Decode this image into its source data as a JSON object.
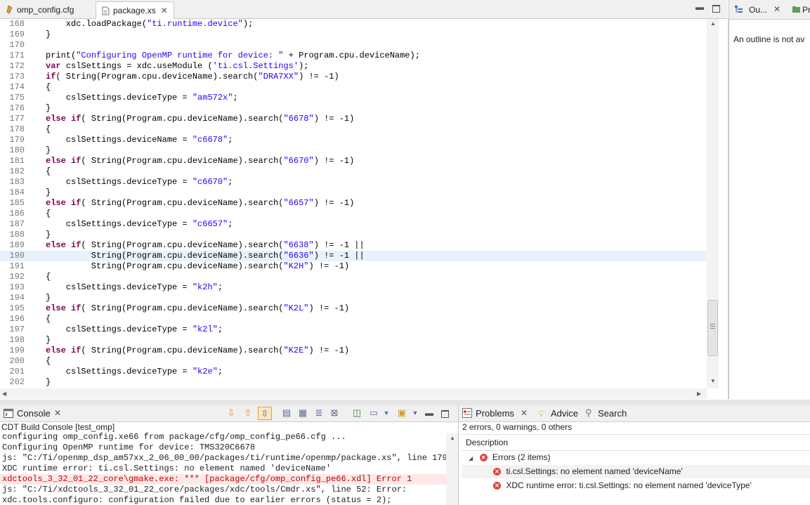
{
  "editor": {
    "tabs": [
      {
        "label": "omp_config.cfg",
        "active": false,
        "icon": "cfg-file-icon"
      },
      {
        "label": "package.xs",
        "active": true,
        "icon": "xs-file-icon"
      }
    ],
    "lines": [
      {
        "num": "168",
        "text": "    xdc.loadPackage(\"ti.runtime.device\");"
      },
      {
        "num": "169",
        "text": "}"
      },
      {
        "num": "170",
        "text": ""
      },
      {
        "num": "171",
        "text": "print(\"Configuring OpenMP runtime for device: \" + Program.cpu.deviceName);"
      },
      {
        "num": "172",
        "text": "var cslSettings = xdc.useModule ('ti.csl.Settings');"
      },
      {
        "num": "173",
        "text": "if( String(Program.cpu.deviceName).search(\"DRA7XX\") != -1)"
      },
      {
        "num": "174",
        "text": "{"
      },
      {
        "num": "175",
        "text": "    cslSettings.deviceType = \"am572x\";"
      },
      {
        "num": "176",
        "text": "}"
      },
      {
        "num": "177",
        "text": "else if( String(Program.cpu.deviceName).search(\"6678\") != -1)"
      },
      {
        "num": "178",
        "text": "{"
      },
      {
        "num": "179",
        "text": "    cslSettings.deviceName = \"c6678\";"
      },
      {
        "num": "180",
        "text": "}"
      },
      {
        "num": "181",
        "text": "else if( String(Program.cpu.deviceName).search(\"6670\") != -1)"
      },
      {
        "num": "182",
        "text": "{"
      },
      {
        "num": "183",
        "text": "    cslSettings.deviceType = \"c6670\";"
      },
      {
        "num": "184",
        "text": "}"
      },
      {
        "num": "185",
        "text": "else if( String(Program.cpu.deviceName).search(\"6657\") != -1)"
      },
      {
        "num": "186",
        "text": "{"
      },
      {
        "num": "187",
        "text": "    cslSettings.deviceType = \"c6657\";"
      },
      {
        "num": "188",
        "text": "}"
      },
      {
        "num": "189",
        "text": "else if( String(Program.cpu.deviceName).search(\"6638\") != -1 ||"
      },
      {
        "num": "190",
        "text": "         String(Program.cpu.deviceName).search(\"6636\") != -1 ||",
        "highlight": true
      },
      {
        "num": "191",
        "text": "         String(Program.cpu.deviceName).search(\"K2H\") != -1)"
      },
      {
        "num": "192",
        "text": "{"
      },
      {
        "num": "193",
        "text": "    cslSettings.deviceType = \"k2h\";"
      },
      {
        "num": "194",
        "text": "}"
      },
      {
        "num": "195",
        "text": "else if( String(Program.cpu.deviceName).search(\"K2L\") != -1)"
      },
      {
        "num": "196",
        "text": "{"
      },
      {
        "num": "197",
        "text": "    cslSettings.deviceType = \"k2l\";"
      },
      {
        "num": "198",
        "text": "}"
      },
      {
        "num": "199",
        "text": "else if( String(Program.cpu.deviceName).search(\"K2E\") != -1)"
      },
      {
        "num": "200",
        "text": "{"
      },
      {
        "num": "201",
        "text": "    cslSettings.deviceType = \"k2e\";"
      },
      {
        "num": "202",
        "text": "}"
      }
    ]
  },
  "outline": {
    "tabs": [
      {
        "label": "Ou...",
        "icon": "outline-icon"
      },
      {
        "label": "Pr",
        "icon": "project-icon"
      }
    ],
    "message": "An outline is not av"
  },
  "console": {
    "tab_label": "Console",
    "title": "CDT Build Console [test_omp]",
    "toolbar_icons": [
      "scroll-down-icon",
      "scroll-up-icon",
      "scroll-lock-icon",
      "copy-console-icon",
      "clear-console-icon",
      "word-wrap-icon",
      "remove-console-icon",
      "pin-console-icon",
      "display-console-icon",
      "display-dropdown-icon",
      "open-console-icon",
      "open-dropdown-icon"
    ],
    "lines": [
      {
        "text": "configuring omp_config.xe66 from package/cfg/omp_config_pe66.cfg ...",
        "error": false
      },
      {
        "text": "Configuring OpenMP runtime for device: TMS320C6678",
        "error": false
      },
      {
        "text": "js: \"C:/Ti/openmp_dsp_am57xx_2_06_00_00/packages/ti/runtime/openmp/package.xs\", line 179:",
        "error": false
      },
      {
        "text": "XDC runtime error: ti.csl.Settings: no element named 'deviceName'",
        "error": false
      },
      {
        "text": "xdctools_3_32_01_22_core\\gmake.exe: *** [package/cfg/omp_config_pe66.xdl] Error 1",
        "error": true
      },
      {
        "text": "js: \"C:/Ti/xdctools_3_32_01_22_core/packages/xdc/tools/Cmdr.xs\", line 52: Error:",
        "error": false
      },
      {
        "text": "xdc.tools.configuro: configuration failed due to earlier errors (status = 2);",
        "error": false
      }
    ]
  },
  "problems": {
    "tabs": [
      {
        "label": "Problems",
        "icon": "problems-icon"
      },
      {
        "label": "Advice",
        "icon": "advice-bulb-icon"
      },
      {
        "label": "Search",
        "icon": "search-icon"
      }
    ],
    "summary": "2 errors, 0 warnings, 0 others",
    "column_header": "Description",
    "group_label": "Errors (2 items)",
    "items": [
      "ti.csl.Settings: no element named 'deviceName'",
      "XDC runtime error: ti.csl.Settings: no element named 'deviceType'"
    ]
  },
  "colors": {
    "error": "#e3433b",
    "string": "#2a00ff",
    "keyword": "#7f0055",
    "line_highlight": "#e8f2fe"
  }
}
